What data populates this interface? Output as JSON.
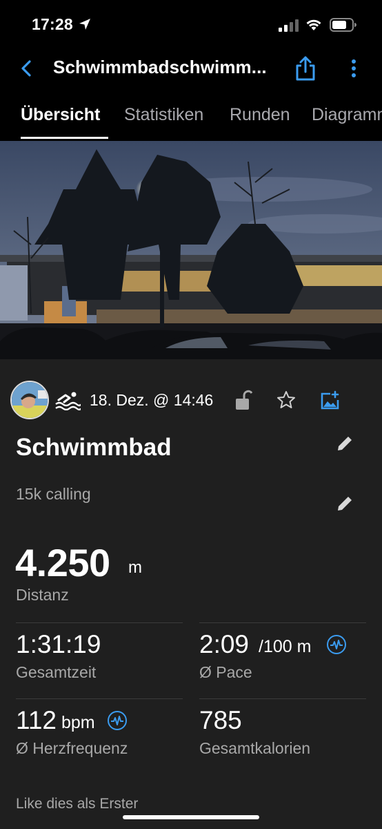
{
  "status_bar": {
    "time": "17:28"
  },
  "nav": {
    "title": "Schwimmbadschwimm..."
  },
  "tabs": [
    {
      "label": "Übersicht",
      "active": true
    },
    {
      "label": "Statistiken",
      "active": false
    },
    {
      "label": "Runden",
      "active": false
    },
    {
      "label": "Diagramme",
      "active": false
    }
  ],
  "activity": {
    "date": "18. Dez. @ 14:46",
    "title": "Schwimmbad",
    "description": "15k calling",
    "distance": {
      "value": "4.250",
      "unit": "m",
      "label": "Distanz"
    }
  },
  "stats": [
    {
      "value": "1:31:19",
      "unit": "",
      "label": "Gesamtzeit"
    },
    {
      "value": "2:09",
      "unit": "/100 m",
      "label": "Ø Pace"
    },
    {
      "value": "112",
      "unit": "bpm",
      "label": "Ø Herzfrequenz"
    },
    {
      "value": "785",
      "unit": "",
      "label": "Gesamtkalorien"
    }
  ],
  "likes": "Like dies als Erster",
  "colors": {
    "accent": "#3b9cf0",
    "background": "#1f1f1f",
    "header": "#000000"
  },
  "icons": [
    "location-arrow-icon",
    "signal-icon",
    "wifi-icon",
    "battery-icon",
    "back-icon",
    "share-icon",
    "more-icon",
    "swim-icon",
    "lock-icon",
    "star-icon",
    "add-photo-icon",
    "edit-icon",
    "heart-rate-icon"
  ]
}
